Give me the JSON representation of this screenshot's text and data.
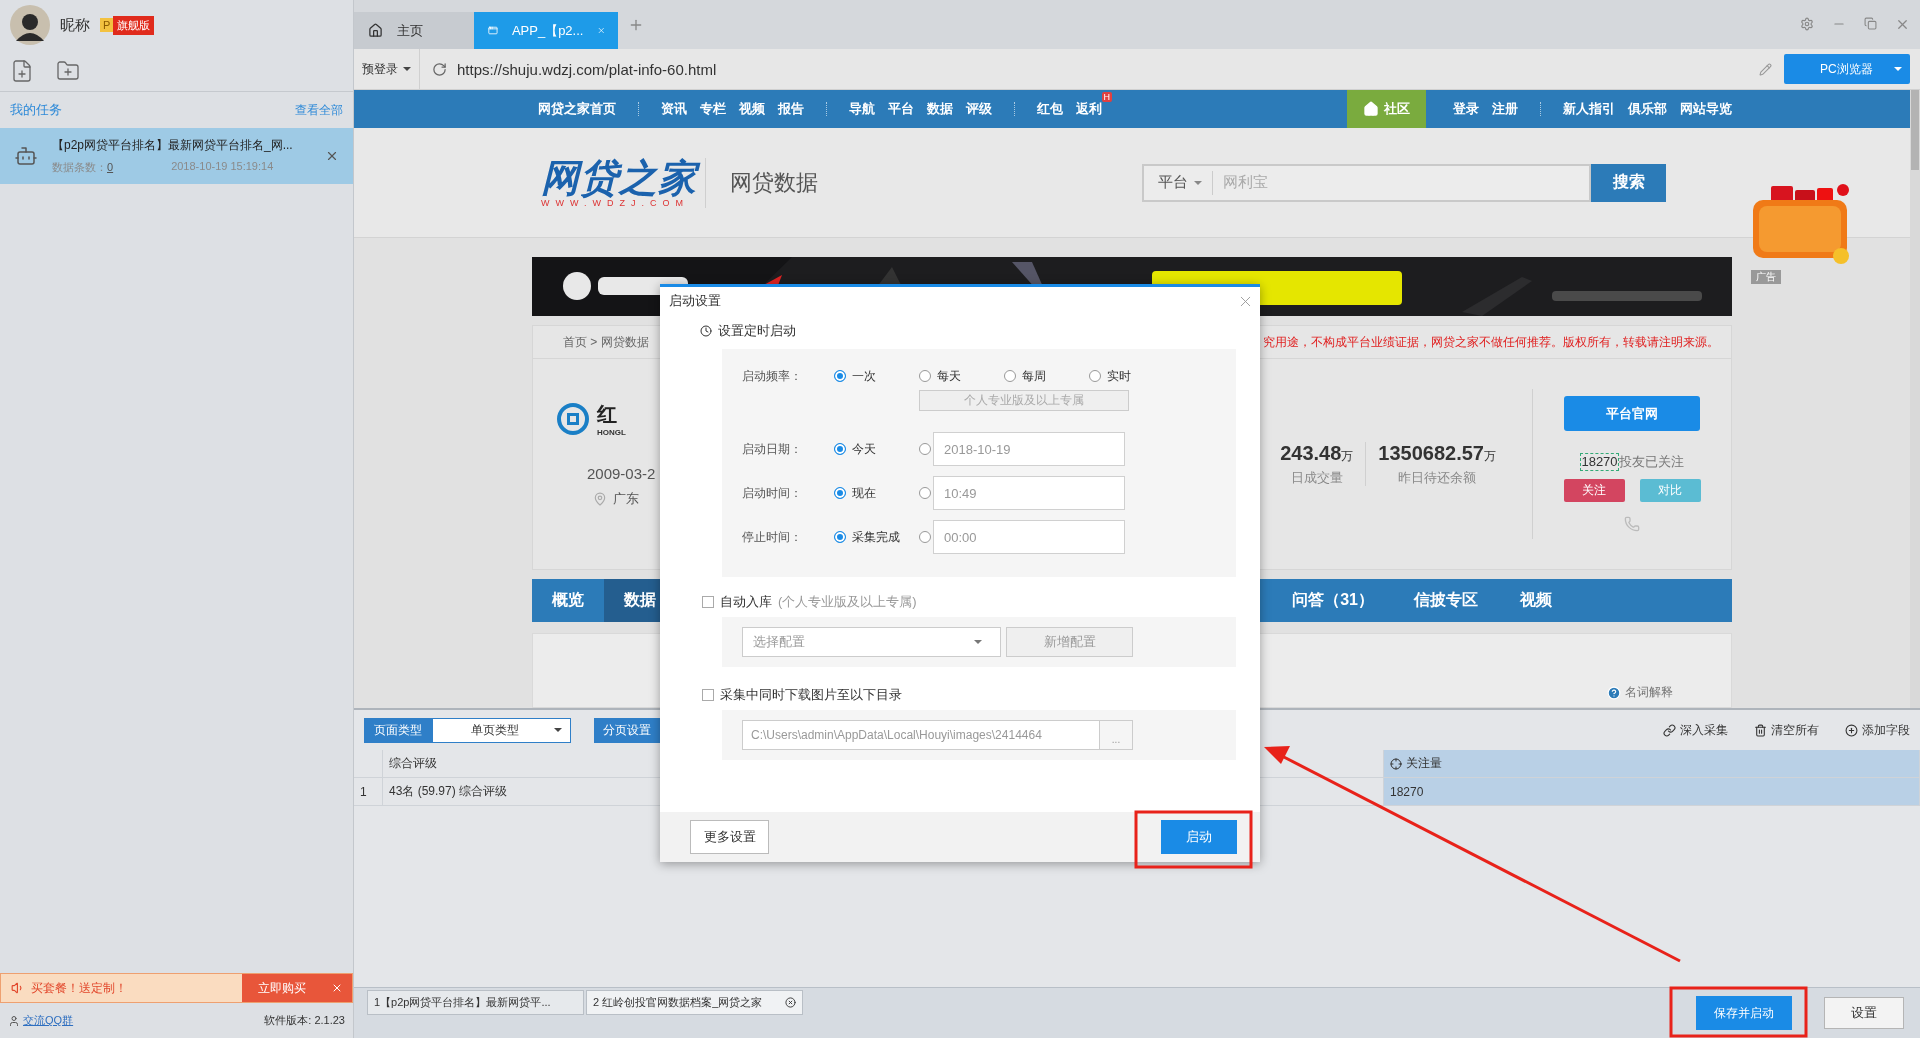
{
  "sidebar": {
    "user": {
      "nickname": "昵称",
      "badge": "P",
      "edition": "旗舰版"
    },
    "tasks_title": "我的任务",
    "view_all": "查看全部",
    "tasks": [
      {
        "title": "【p2p网贷平台排名】最新网贷平台排名_网...",
        "count_label": "数据条数：",
        "count": "0",
        "time": "2018-10-19 15:19:14",
        "selected": true
      }
    ],
    "promo": {
      "text": "买套餐！送定制！",
      "button": "立即购买"
    },
    "qq_link": "交流QQ群",
    "version": "软件版本: 2.1.23"
  },
  "browser": {
    "tabs": [
      {
        "label": "主页",
        "kind": "home",
        "selected": false
      },
      {
        "label": "APP_【p2...",
        "kind": "page",
        "selected": true
      }
    ],
    "login_menu": "预登录",
    "url": "https://shuju.wdzj.com/plat-info-60.html",
    "mode_button": "PC浏览器"
  },
  "site": {
    "nav_left": [
      {
        "items": [
          {
            "label": "网贷之家首页"
          }
        ]
      },
      {
        "items": [
          {
            "label": "资讯"
          },
          {
            "label": "专栏"
          },
          {
            "label": "视频"
          },
          {
            "label": "报告"
          }
        ]
      },
      {
        "items": [
          {
            "label": "导航"
          },
          {
            "label": "平台"
          },
          {
            "label": "数据"
          },
          {
            "label": "评级"
          }
        ]
      },
      {
        "items": [
          {
            "label": "红包"
          },
          {
            "label": "返利",
            "badge": "H"
          }
        ]
      }
    ],
    "community": "社区",
    "nav_right": [
      {
        "items": [
          {
            "label": "登录"
          },
          {
            "label": "注册"
          }
        ]
      },
      {
        "items": [
          {
            "label": "新人指引"
          },
          {
            "label": "俱乐部"
          },
          {
            "label": "网站导览"
          }
        ]
      }
    ],
    "logo": "网贷之家",
    "logo_url": "WWW.WDZJ.COM",
    "section": "网贷数据",
    "search": {
      "scope": "平台",
      "placeholder": "网利宝",
      "button": "搜索"
    },
    "ad_tag": "广告",
    "breadcrumb": "首页 > 网贷数据",
    "notice": "究用途，不构成平台业绩证据，网贷之家不做任何推荐。版权所有，转载请注明来源。",
    "platform": {
      "name": "红",
      "name_en": "HONGL",
      "founded": "2009-03-2",
      "location": "广东"
    },
    "stats": [
      {
        "value": "243.48",
        "unit": "万",
        "label": "日成交量"
      },
      {
        "value": "1350682.57",
        "unit": "万",
        "label": "昨日待还余额"
      }
    ],
    "official_button": "平台官网",
    "followers": "18270",
    "followers_label": "投友已关注",
    "follow_button": "关注",
    "compare_button": "对比",
    "page_tabs": [
      {
        "label": "概览",
        "selected": false
      },
      {
        "label": "数据",
        "selected": true
      }
    ],
    "page_tabs_more": [
      {
        "label": "问答（31）",
        "selected": false
      },
      {
        "label": "信披专区",
        "selected": false
      },
      {
        "label": "视频",
        "selected": false
      }
    ],
    "glossary": "名词解释"
  },
  "bottom_panel": {
    "page_type_label": "页面类型",
    "page_type": "单页类型",
    "paging_button": "分页设置",
    "actions": [
      {
        "label": "深入采集",
        "kind": "link"
      },
      {
        "label": "清空所有",
        "kind": "trash"
      },
      {
        "label": "添加字段",
        "kind": "add"
      }
    ],
    "table": {
      "columns": [
        {
          "label": "综合评级",
          "selected": false
        },
        {
          "label": "关注量",
          "selected": true
        }
      ],
      "rows": [
        {
          "index": "1",
          "cells": [
            "43名 (59.97) 综合评级",
            "18270"
          ]
        }
      ]
    }
  },
  "task_tabs": [
    {
      "label": "1【p2p网贷平台排名】最新网贷平...",
      "closable": false
    },
    {
      "label": "2 红岭创投官网数据档案_网贷之家",
      "closable": true
    }
  ],
  "save_start_button": "保存并启动",
  "settings_button": "设置",
  "dialog": {
    "title": "启动设置",
    "schedule_label": "设置定时启动",
    "frequency": {
      "label": "启动频率：",
      "options": [
        {
          "label": "一次",
          "selected": true
        },
        {
          "label": "每天",
          "selected": false
        },
        {
          "label": "每周",
          "selected": false
        },
        {
          "label": "实时",
          "selected": false
        }
      ],
      "note": "个人专业版及以上专属"
    },
    "rows": [
      {
        "label": "启动日期：",
        "preset": {
          "label": "今天",
          "selected": true
        },
        "custom": {
          "value": "2018-10-19",
          "selected": false
        }
      },
      {
        "label": "启动时间：",
        "preset": {
          "label": "现在",
          "selected": true
        },
        "custom": {
          "value": "10:49",
          "selected": false
        }
      },
      {
        "label": "停止时间：",
        "preset": {
          "label": "采集完成",
          "selected": true
        },
        "custom": {
          "value": "00:00",
          "selected": false
        }
      }
    ],
    "auto_store": {
      "label": "自动入库",
      "note": "(个人专业版及以上专属)",
      "checked": false,
      "select_placeholder": "选择配置",
      "add_button": "新增配置"
    },
    "download": {
      "label": "采集中同时下载图片至以下目录",
      "checked": false,
      "path": "C:\\Users\\admin\\AppData\\Local\\Houyi\\images\\2414464",
      "browse": "..."
    },
    "more_button": "更多设置",
    "start_button": "启动"
  }
}
